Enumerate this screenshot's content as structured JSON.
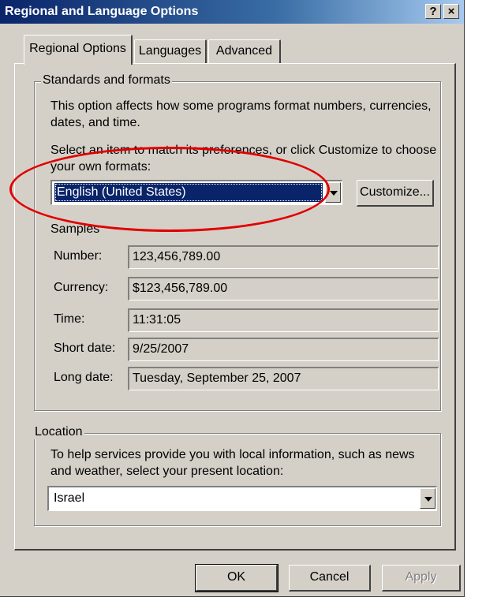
{
  "window": {
    "title": "Regional and Language Options",
    "help_glyph": "?",
    "close_glyph": "×"
  },
  "tabs": [
    {
      "label": "Regional Options",
      "active": true
    },
    {
      "label": "Languages",
      "active": false
    },
    {
      "label": "Advanced",
      "active": false
    }
  ],
  "standards": {
    "legend": "Standards and formats",
    "description": "This option affects how some programs format numbers, currencies, dates, and time.",
    "select_prompt": "Select an item to match its preferences, or click Customize to choose your own formats:",
    "format_value": "English (United States)",
    "customize_label": "Customize...",
    "samples_label": "Samples",
    "samples": [
      {
        "label": "Number:",
        "value": "123,456,789.00"
      },
      {
        "label": "Currency:",
        "value": "$123,456,789.00"
      },
      {
        "label": "Time:",
        "value": "11:31:05"
      },
      {
        "label": "Short date:",
        "value": "9/25/2007"
      },
      {
        "label": "Long date:",
        "value": "Tuesday, September 25, 2007"
      }
    ]
  },
  "location": {
    "legend": "Location",
    "description": "To help services provide you with local information, such as news and weather, select your present location:",
    "value": "Israel"
  },
  "buttons": {
    "ok": "OK",
    "cancel": "Cancel",
    "apply": "Apply"
  },
  "colors": {
    "annotation": "#e00000",
    "selection": "#0a246a"
  }
}
